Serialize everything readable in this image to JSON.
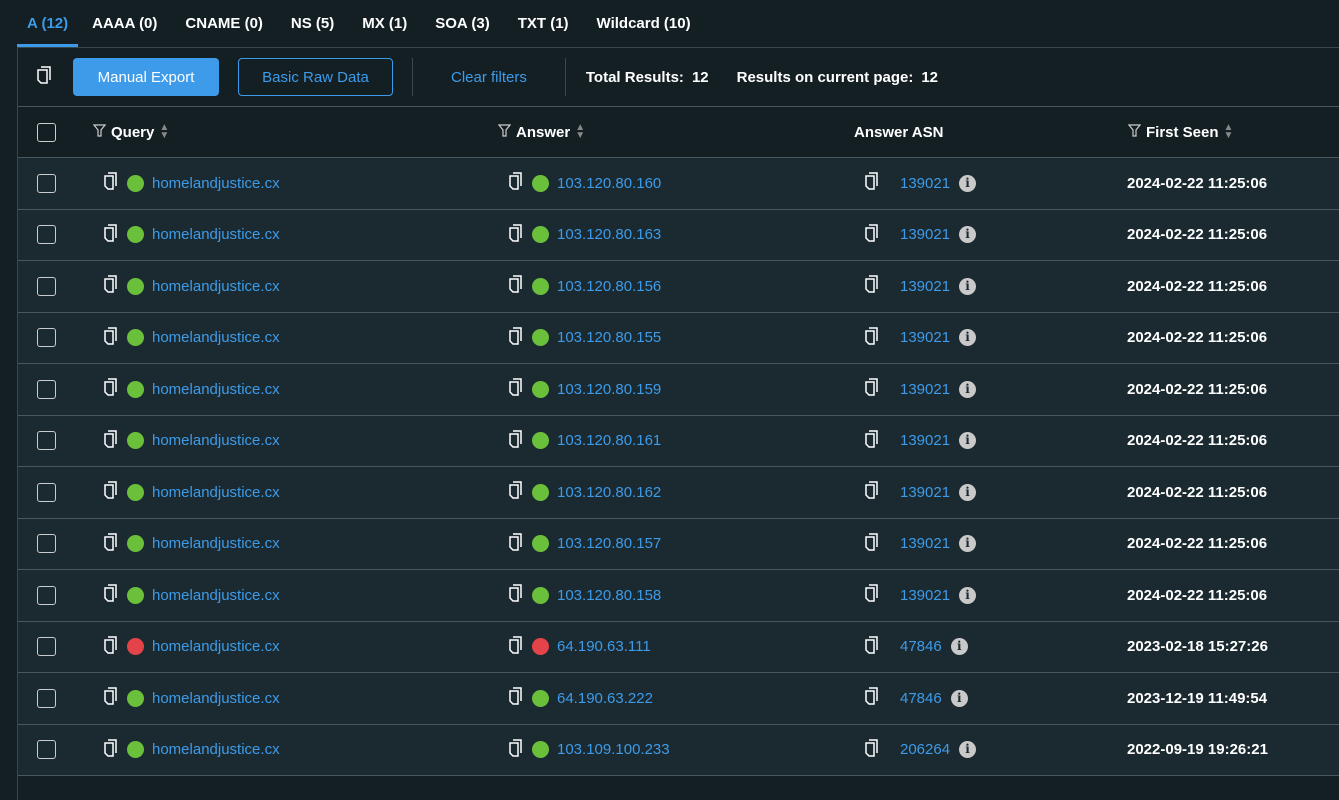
{
  "tabs": [
    "A (12)",
    "AAAA (0)",
    "CNAME (0)",
    "NS (5)",
    "MX (1)",
    "SOA (3)",
    "TXT (1)",
    "Wildcard (10)"
  ],
  "toolbar": {
    "manual_export": "Manual Export",
    "basic_raw": "Basic Raw Data",
    "clear_filters": "Clear filters",
    "total_label": "Total Results:",
    "total": "12",
    "page_label": "Results on current page:",
    "page_count": "12"
  },
  "columns": {
    "query": "Query",
    "answer": "Answer",
    "asn": "Answer ASN",
    "first_seen": "First Seen"
  },
  "colors": {
    "green": "#6abf3b",
    "red": "#e5434a",
    "accent": "#3d9be9"
  },
  "rows": [
    {
      "query": "homelandjustice.cx",
      "answer": "103.120.80.160",
      "status": "green",
      "asn": "139021",
      "first_seen": "2024-02-22 11:25:06"
    },
    {
      "query": "homelandjustice.cx",
      "answer": "103.120.80.163",
      "status": "green",
      "asn": "139021",
      "first_seen": "2024-02-22 11:25:06"
    },
    {
      "query": "homelandjustice.cx",
      "answer": "103.120.80.156",
      "status": "green",
      "asn": "139021",
      "first_seen": "2024-02-22 11:25:06"
    },
    {
      "query": "homelandjustice.cx",
      "answer": "103.120.80.155",
      "status": "green",
      "asn": "139021",
      "first_seen": "2024-02-22 11:25:06"
    },
    {
      "query": "homelandjustice.cx",
      "answer": "103.120.80.159",
      "status": "green",
      "asn": "139021",
      "first_seen": "2024-02-22 11:25:06"
    },
    {
      "query": "homelandjustice.cx",
      "answer": "103.120.80.161",
      "status": "green",
      "asn": "139021",
      "first_seen": "2024-02-22 11:25:06"
    },
    {
      "query": "homelandjustice.cx",
      "answer": "103.120.80.162",
      "status": "green",
      "asn": "139021",
      "first_seen": "2024-02-22 11:25:06"
    },
    {
      "query": "homelandjustice.cx",
      "answer": "103.120.80.157",
      "status": "green",
      "asn": "139021",
      "first_seen": "2024-02-22 11:25:06"
    },
    {
      "query": "homelandjustice.cx",
      "answer": "103.120.80.158",
      "status": "green",
      "asn": "139021",
      "first_seen": "2024-02-22 11:25:06"
    },
    {
      "query": "homelandjustice.cx",
      "answer": "64.190.63.111",
      "status": "red",
      "asn": "47846",
      "first_seen": "2023-02-18 15:27:26"
    },
    {
      "query": "homelandjustice.cx",
      "answer": "64.190.63.222",
      "status": "green",
      "asn": "47846",
      "first_seen": "2023-12-19 11:49:54"
    },
    {
      "query": "homelandjustice.cx",
      "answer": "103.109.100.233",
      "status": "green",
      "asn": "206264",
      "first_seen": "2022-09-19 19:26:21"
    }
  ]
}
